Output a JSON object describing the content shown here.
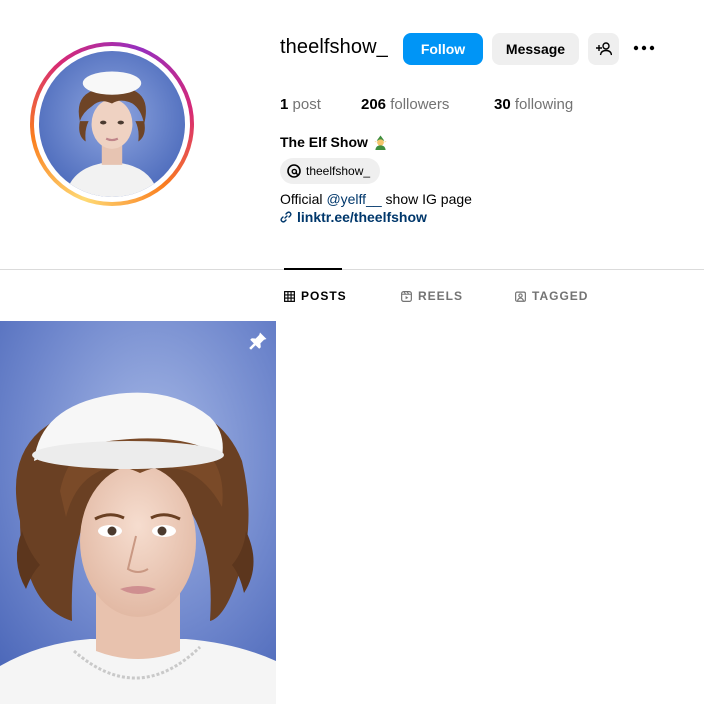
{
  "profile": {
    "username": "theelfshow_",
    "display_name": "The Elf Show",
    "display_name_emoji": "elf-emoji",
    "threads_handle": "theelfshow_",
    "bio_prefix": "Official ",
    "bio_mention": "@yelff__",
    "bio_suffix": " show IG page",
    "link": "linktr.ee/theelfshow"
  },
  "actions": {
    "follow_label": "Follow",
    "message_label": "Message"
  },
  "stats": {
    "posts_count": "1",
    "posts_label": "post",
    "followers_count": "206",
    "followers_label": "followers",
    "following_count": "30",
    "following_label": "following"
  },
  "tabs": [
    {
      "label": "POSTS",
      "icon": "grid-icon",
      "active": true
    },
    {
      "label": "REELS",
      "icon": "reels-icon",
      "active": false
    },
    {
      "label": "TAGGED",
      "icon": "tagged-icon",
      "active": false
    }
  ],
  "colors": {
    "follow_button": "#0095f6",
    "secondary_button": "#efefef",
    "link": "#00376b",
    "muted_text": "#737373",
    "photo_background": "#5b78c4"
  },
  "posts": [
    {
      "pinned": true,
      "icon": "pin-icon"
    }
  ]
}
